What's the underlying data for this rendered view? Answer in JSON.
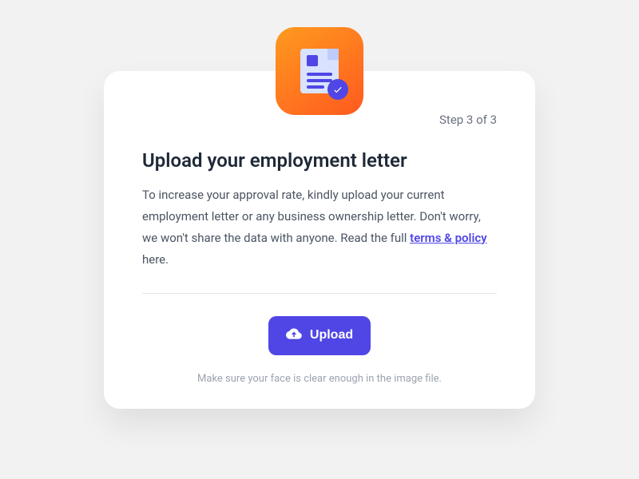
{
  "step": "Step 3 of 3",
  "title": "Upload your employment letter",
  "desc_before": "To increase your approval rate, kindly upload your current employment letter or any business ownership letter. Don't worry, we won't share the data with anyone. Read the full ",
  "link_text": "terms & policy",
  "desc_after": " here.",
  "button_label": "Upload",
  "hint": "Make sure your face is clear enough in the image file.",
  "colors": {
    "accent": "#4f46e5",
    "icon_gradient_start": "#ff9a1f",
    "icon_gradient_end": "#ff5a1f"
  }
}
